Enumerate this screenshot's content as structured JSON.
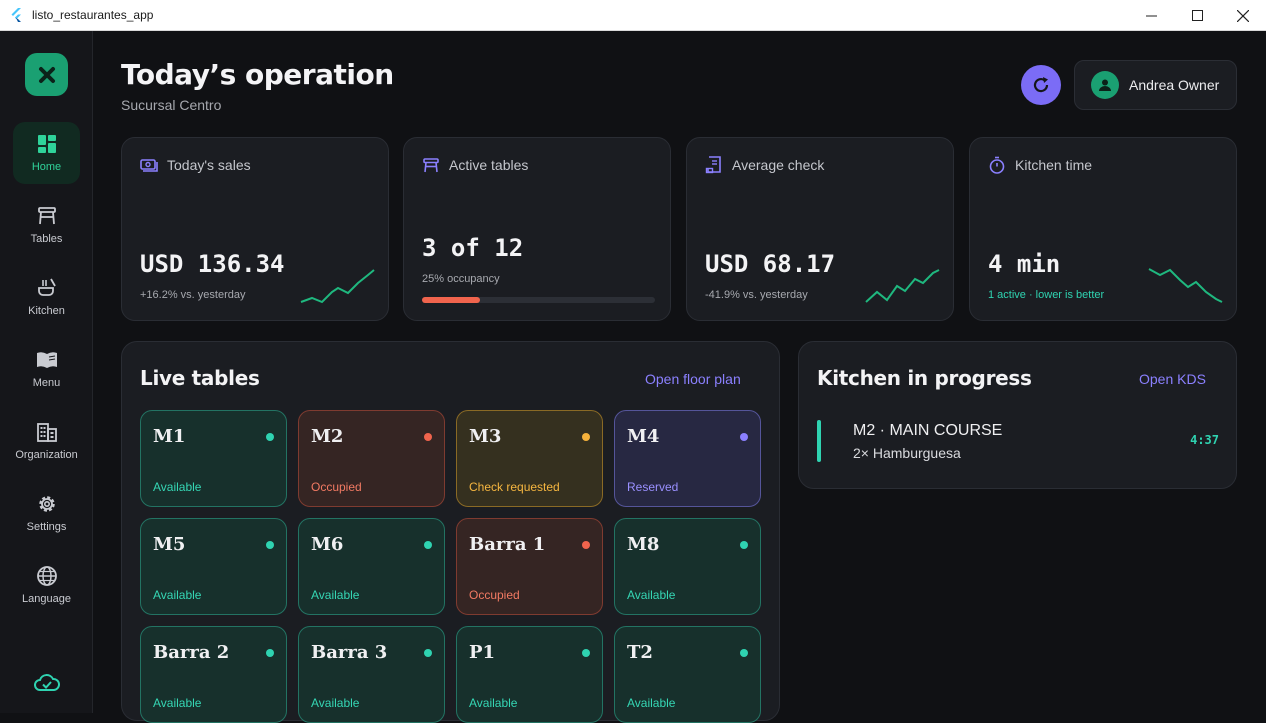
{
  "window": {
    "title": "listo_restaurantes_app"
  },
  "sidebar": {
    "items": [
      {
        "label": "Home",
        "icon": "dashboard-icon"
      },
      {
        "label": "Tables",
        "icon": "table-icon"
      },
      {
        "label": "Kitchen",
        "icon": "kitchen-icon"
      },
      {
        "label": "Menu",
        "icon": "menu-book-icon"
      },
      {
        "label": "Organization",
        "icon": "organization-icon"
      },
      {
        "label": "Settings",
        "icon": "gear-icon"
      },
      {
        "label": "Language",
        "icon": "globe-icon"
      }
    ],
    "active": "Home",
    "sync_icon": "cloud-check-icon"
  },
  "header": {
    "title": "Today’s operation",
    "subtitle": "Sucursal Centro",
    "user_name": "Andrea Owner"
  },
  "kpis": [
    {
      "label": "Today's sales",
      "value": "USD 136.34",
      "sub": "+16.2% vs. yesterday",
      "icon": "cash-icon"
    },
    {
      "label": "Active tables",
      "value": "3 of 12",
      "sub": "25% occupancy",
      "icon": "table-icon",
      "progress": 0.25
    },
    {
      "label": "Average check",
      "value": "USD 68.17",
      "sub": "-41.9% vs. yesterday",
      "icon": "receipt-icon"
    },
    {
      "label": "Kitchen time",
      "value": "4 min",
      "sub": "1 active · lower is better",
      "icon": "timer-icon"
    }
  ],
  "live_tables": {
    "title": "Live tables",
    "link": "Open floor plan",
    "tables": [
      {
        "name": "M1",
        "status": "Available"
      },
      {
        "name": "M2",
        "status": "Occupied"
      },
      {
        "name": "M3",
        "status": "Check requested"
      },
      {
        "name": "M4",
        "status": "Reserved"
      },
      {
        "name": "M5",
        "status": "Available"
      },
      {
        "name": "M6",
        "status": "Available"
      },
      {
        "name": "Barra 1",
        "status": "Occupied"
      },
      {
        "name": "M8",
        "status": "Available"
      },
      {
        "name": "Barra 2",
        "status": "Available"
      },
      {
        "name": "Barra 3",
        "status": "Available"
      },
      {
        "name": "P1",
        "status": "Available"
      },
      {
        "name": "T2",
        "status": "Available"
      }
    ]
  },
  "kitchen": {
    "title": "Kitchen in progress",
    "link": "Open KDS",
    "orders": [
      {
        "title": "M2 · MAIN COURSE",
        "item": "2× Hamburguesa",
        "time": "4:37"
      }
    ]
  },
  "colors": {
    "accent": "#7b6cf6",
    "brand": "#1aa072",
    "available": "#2fd3b1",
    "occupied": "#f0644d",
    "check": "#f6b23b",
    "reserved": "#8b80ff"
  }
}
